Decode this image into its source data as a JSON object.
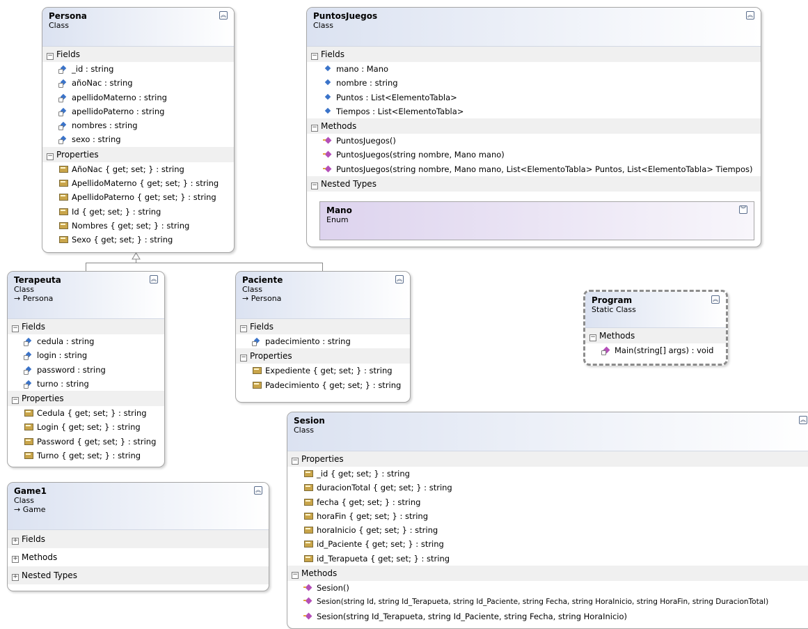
{
  "classes": {
    "persona": {
      "name": "Persona",
      "stereotype": "Class",
      "sections": {
        "fields": "Fields",
        "properties": "Properties"
      },
      "fields": [
        "_id : string",
        "añoNac : string",
        "apellidoMaterno : string",
        "apellidoPaterno : string",
        "nombres : string",
        "sexo : string"
      ],
      "properties": [
        "AñoNac { get; set; } : string",
        "ApellidoMaterno { get; set; } : string",
        "ApellidoPaterno { get; set; } : string",
        "Id { get; set; } : string",
        "Nombres { get; set; } : string",
        "Sexo { get; set; } : string"
      ]
    },
    "puntos": {
      "name": "PuntosJuegos",
      "stereotype": "Class",
      "sections": {
        "fields": "Fields",
        "methods": "Methods",
        "nested": "Nested Types"
      },
      "fields": [
        "mano : Mano",
        "nombre : string",
        "Puntos : List<ElementoTabla>",
        "Tiempos : List<ElementoTabla>"
      ],
      "methods": [
        "PuntosJuegos()",
        "PuntosJuegos(string nombre, Mano mano)",
        "PuntosJuegos(string nombre, Mano mano,  List<ElementoTabla> Puntos, List<ElementoTabla> Tiempos)"
      ],
      "nested_type": {
        "name": "Mano",
        "stereotype": "Enum"
      }
    },
    "terapeuta": {
      "name": "Terapeuta",
      "stereotype": "Class",
      "inherits": "→ Persona",
      "sections": {
        "fields": "Fields",
        "properties": "Properties"
      },
      "fields": [
        "cedula : string",
        "login : string",
        "password : string",
        "turno : string"
      ],
      "properties": [
        "Cedula { get; set; } : string",
        "Login { get; set; } : string",
        "Password { get; set; } : string",
        "Turno { get; set; } : string"
      ]
    },
    "paciente": {
      "name": "Paciente",
      "stereotype": "Class",
      "inherits": "→ Persona",
      "sections": {
        "fields": "Fields",
        "properties": "Properties"
      },
      "fields": [
        "padecimiento : string"
      ],
      "properties": [
        "Expediente { get; set; } : string",
        "Padecimiento { get; set; } : string"
      ]
    },
    "program": {
      "name": "Program",
      "stereotype": "Static Class",
      "sections": {
        "methods": "Methods"
      },
      "methods": [
        "Main(string[] args) : void"
      ]
    },
    "sesion": {
      "name": "Sesion",
      "stereotype": "Class",
      "sections": {
        "properties": "Properties",
        "methods": "Methods"
      },
      "properties": [
        "_id { get; set; } : string",
        "duracionTotal { get; set; } : string",
        "fecha { get; set; } : string",
        "horaFin { get; set; } : string",
        "horaInicio { get; set; } : string",
        "id_Paciente { get; set; } : string",
        "id_Terapueta { get; set; } : string"
      ],
      "methods": [
        "Sesion()",
        "Sesion(string Id, string Id_Terapueta, string Id_Paciente, string Fecha, string HoraInicio, string HoraFin, string DuracionTotal)",
        "Sesion(string Id_Terapueta, string Id_Paciente, string Fecha, string HoraInicio)"
      ]
    },
    "game1": {
      "name": "Game1",
      "stereotype": "Class",
      "inherits": "→ Game",
      "sections": {
        "fields": "Fields",
        "methods": "Methods",
        "nested": "Nested Types"
      }
    }
  },
  "icons": {
    "collapse": "double-chevron-up-icon",
    "expand": "double-chevron-down-icon"
  },
  "colors": {
    "header": "#dbe2f1",
    "enum_header": "#ddd3ee",
    "section": "#f0f0f0",
    "border": "#a6a6a6"
  }
}
